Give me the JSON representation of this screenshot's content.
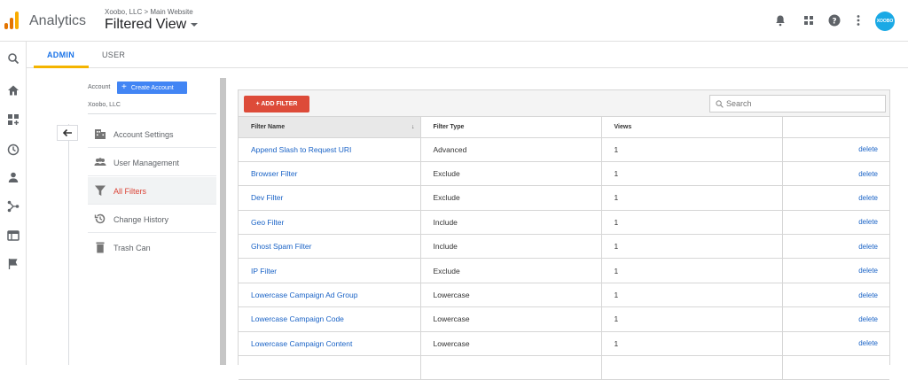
{
  "header": {
    "app_name": "Analytics",
    "breadcrumb": "Xoobo, LLC > Main Website",
    "view_title": "Filtered View",
    "avatar_text": "XOOBO",
    "icons": [
      "bell-icon",
      "apps-grid-icon",
      "help-icon",
      "more-vert-icon"
    ],
    "logo_colors": [
      "#f9ab00",
      "#e37400",
      "#e37400"
    ]
  },
  "left_rail": {
    "icons": [
      "search-icon",
      "home-icon",
      "customization-icon",
      "realtime-clock-icon",
      "audience-person-icon",
      "acquisition-icon",
      "behavior-icon",
      "conversions-flag-icon"
    ]
  },
  "tabs": [
    {
      "label": "ADMIN",
      "active": true
    },
    {
      "label": "USER",
      "active": false
    }
  ],
  "admin": {
    "account_label": "Account",
    "create_button": "Create Account",
    "account_name": "Xoobo, LLC",
    "back_icon": "back-arrow-icon",
    "nav_items": [
      {
        "label": "Account Settings",
        "icon": "building-icon",
        "active": false
      },
      {
        "label": "User Management",
        "icon": "people-icon",
        "active": false
      },
      {
        "label": "All Filters",
        "icon": "filter-icon",
        "active": true
      },
      {
        "label": "Change History",
        "icon": "history-icon",
        "active": false
      },
      {
        "label": "Trash Can",
        "icon": "trash-icon",
        "active": false
      }
    ]
  },
  "toolbar": {
    "add_filter_label": "+ ADD FILTER",
    "search_placeholder": "Search"
  },
  "table": {
    "columns": [
      "Filter Name",
      "Filter Type",
      "Views",
      ""
    ],
    "delete_label": "delete",
    "rows": [
      {
        "name": "Append Slash to Request URI",
        "type": "Advanced",
        "views": "1"
      },
      {
        "name": "Browser Filter",
        "type": "Exclude",
        "views": "1"
      },
      {
        "name": "Dev Filter",
        "type": "Exclude",
        "views": "1"
      },
      {
        "name": "Geo Filter",
        "type": "Include",
        "views": "1"
      },
      {
        "name": "Ghost Spam Filter",
        "type": "Include",
        "views": "1"
      },
      {
        "name": "IP Filter",
        "type": "Exclude",
        "views": "1"
      },
      {
        "name": "Lowercase Campaign Ad Group",
        "type": "Lowercase",
        "views": "1"
      },
      {
        "name": "Lowercase Campaign Code",
        "type": "Lowercase",
        "views": "1"
      },
      {
        "name": "Lowercase Campaign Content",
        "type": "Lowercase",
        "views": "1"
      },
      {
        "name": "",
        "type": "",
        "views": "",
        "partial": true
      }
    ]
  },
  "colors": {
    "accent_blue": "#4285f4",
    "link_blue": "#1a63c6",
    "add_filter_red": "#dd4b39",
    "active_nav_red": "#db4437",
    "tab_underline": "#f4b400"
  }
}
